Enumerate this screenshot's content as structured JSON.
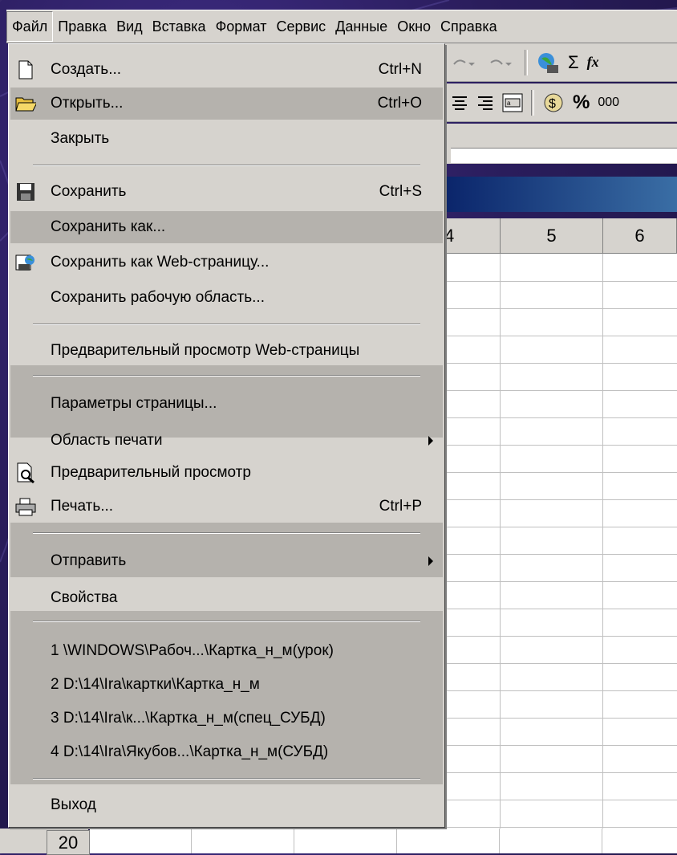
{
  "menubar": {
    "items": [
      "Файл",
      "Правка",
      "Вид",
      "Вставка",
      "Формат",
      "Сервис",
      "Данные",
      "Окно",
      "Справка"
    ]
  },
  "toolbar": {
    "icons": [
      "undo-icon",
      "redo-icon",
      "web-icon",
      "sum-icon",
      "function-icon",
      "align-center-icon",
      "align-right-icon",
      "merge-icon",
      "currency-icon",
      "percent-icon",
      "thousands-icon"
    ],
    "sum_glyph": "Σ",
    "fx_glyph": "fx",
    "percent_glyph": "%",
    "thousands_glyph": "000"
  },
  "grid": {
    "columns": [
      "4",
      "5",
      "6"
    ],
    "row_label": "20"
  },
  "file_menu": {
    "items": [
      {
        "label": "Создать...",
        "shortcut": "Ctrl+N",
        "icon": "new-document-icon"
      },
      {
        "label": "Открыть...",
        "shortcut": "Ctrl+O",
        "icon": "open-folder-icon"
      },
      {
        "label": "Закрыть",
        "shortcut": ""
      },
      {
        "label": "Сохранить",
        "shortcut": "Ctrl+S",
        "icon": "save-disk-icon"
      },
      {
        "label": "Сохранить как...",
        "shortcut": ""
      },
      {
        "label": "Сохранить как Web-страницу...",
        "shortcut": "",
        "icon": "web-page-icon"
      },
      {
        "label": "Сохранить рабочую область...",
        "shortcut": ""
      },
      {
        "label": "Предварительный просмотр Web-страницы",
        "shortcut": ""
      },
      {
        "label": "Параметры страницы...",
        "shortcut": ""
      },
      {
        "label": "Область печати",
        "shortcut": "",
        "submenu": true
      },
      {
        "label": "Предварительный просмотр",
        "shortcut": "",
        "icon": "print-preview-icon"
      },
      {
        "label": "Печать...",
        "shortcut": "Ctrl+P",
        "icon": "printer-icon"
      },
      {
        "label": "Отправить",
        "shortcut": "",
        "submenu": true
      },
      {
        "label": "Свойства",
        "shortcut": ""
      },
      {
        "label": "1 \\WINDOWS\\Рабоч...\\Картка_н_м(урок)",
        "shortcut": ""
      },
      {
        "label": "2 D:\\14\\Ira\\картки\\Картка_н_м",
        "shortcut": ""
      },
      {
        "label": "3 D:\\14\\Ira\\к...\\Картка_н_м(спец_СУБД)",
        "shortcut": ""
      },
      {
        "label": "4 D:\\14\\Ira\\Якубов...\\Картка_н_м(СУБД)",
        "shortcut": ""
      },
      {
        "label": "Выход",
        "shortcut": ""
      }
    ]
  },
  "colors": {
    "menu_bg": "#d6d3ce",
    "highlight": "#b5b2ad",
    "title_bar": "#0a246a"
  }
}
